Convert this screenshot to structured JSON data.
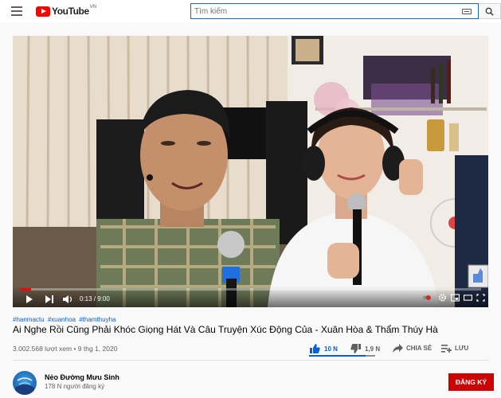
{
  "masthead": {
    "logo_text": "YouTube",
    "logo_region": "VN",
    "search_placeholder": "Tìm kiếm"
  },
  "player": {
    "time_current": "0:13",
    "time_total": "9:00",
    "time_display": "0:13 / 9:00",
    "progress_fraction": 0.024
  },
  "video": {
    "hashtags": [
      "#hanmactu",
      "#xuanhoa",
      "#thamthuyha"
    ],
    "title": "Ai Nghe Rồi Cũng Phải Khóc Giọng Hát Và Câu Truyện Xúc Động Của - Xuân Hòa & Thẩm Thúy Hà",
    "views": "3.002.568 lượt xem",
    "date": "9 thg 1, 2020",
    "meta": "3.002.568 lượt xem • 9 thg 1, 2020",
    "like_count": "10 N",
    "dislike_count": "1,9 N",
    "share_label": "CHIA SẺ",
    "save_label": "LƯU"
  },
  "channel": {
    "name": "Nẻo Đường Mưu Sinh",
    "subscribers": "178 N người đăng ký",
    "subscribe_label": "ĐĂNG KÝ"
  },
  "colors": {
    "brand_red": "#ff0000",
    "link_blue": "#065fd4",
    "subscribe_red": "#cc0000"
  }
}
